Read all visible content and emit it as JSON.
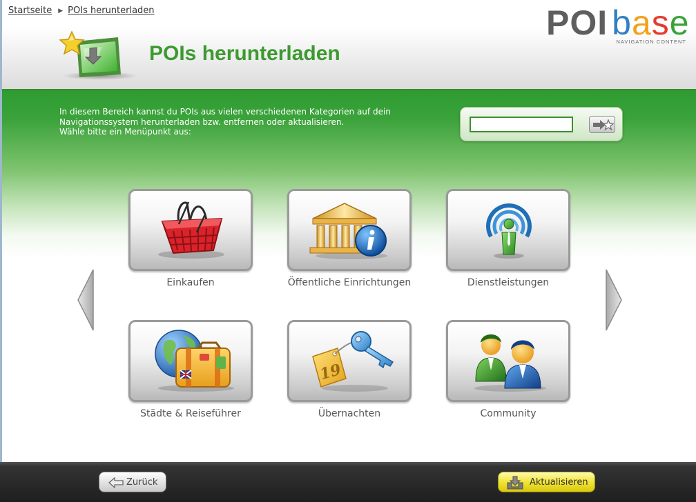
{
  "breadcrumb": {
    "home": "Startseite",
    "current": "POIs herunterladen"
  },
  "header": {
    "title": "POIs herunterladen"
  },
  "logo": {
    "poi": "POI",
    "base": "base",
    "tagline": "NAVIGATION CONTENT",
    "colors": [
      "#2f7fc4",
      "#f1a11d",
      "#e63a2e",
      "#3aa23a"
    ]
  },
  "intro": {
    "line1": "In diesem Bereich kannst du POIs aus vielen verschiedenen Kategorien auf dein",
    "line2": "Navigationssystem herunterladen bzw. entfernen oder aktualisieren.",
    "line3": "Wähle bitte ein Menüpunkt aus:"
  },
  "search": {
    "value": "",
    "button_icon": "search-arrow-star-icon"
  },
  "categories": [
    {
      "label": "Einkaufen",
      "icon": "shopping-basket-icon"
    },
    {
      "label": "Öffentliche Einrichtungen",
      "icon": "public-building-info-icon"
    },
    {
      "label": "Dienstleistungen",
      "icon": "service-person-signal-icon"
    },
    {
      "label": "Städte & Reiseführer",
      "icon": "globe-suitcase-icon"
    },
    {
      "label": "Übernachten",
      "icon": "hotel-key-icon"
    },
    {
      "label": "Community",
      "icon": "community-people-icon"
    }
  ],
  "footer": {
    "back_label": "Zurück",
    "update_label": "Aktualisieren"
  },
  "colors": {
    "title_green": "#3c9a2f",
    "main_green": "#2e9c31",
    "update_yellow": "#f1e437"
  }
}
